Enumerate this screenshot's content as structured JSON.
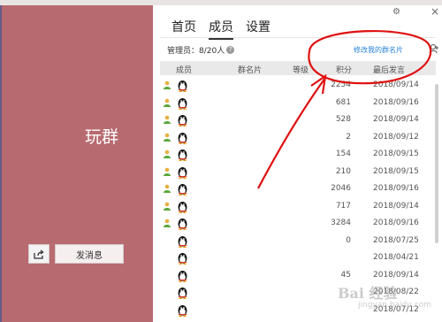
{
  "group": {
    "name": "玩群"
  },
  "left_actions": {
    "send_message_label": "发消息"
  },
  "window_controls": {
    "settings": "⚙",
    "close": "×"
  },
  "tabs": [
    {
      "label": "首页",
      "active": false
    },
    {
      "label": "成员",
      "active": true
    },
    {
      "label": "设置",
      "active": false
    }
  ],
  "members_header": {
    "admin_count": "管理员：8/20人",
    "edit_card_label": "修改我的群名片"
  },
  "table": {
    "columns": [
      "成员",
      "群名片",
      "等级",
      "积分",
      "最后发言"
    ],
    "rows": [
      {
        "admin": true,
        "points": "2254",
        "last": "2018/09/14"
      },
      {
        "admin": true,
        "points": "681",
        "last": "2018/09/16"
      },
      {
        "admin": true,
        "points": "528",
        "last": "2018/09/14"
      },
      {
        "admin": true,
        "points": "2",
        "last": "2018/09/12"
      },
      {
        "admin": true,
        "points": "154",
        "last": "2018/09/15"
      },
      {
        "admin": true,
        "points": "210",
        "last": "2018/09/15"
      },
      {
        "admin": true,
        "points": "2046",
        "last": "2018/09/16"
      },
      {
        "admin": true,
        "points": "717",
        "last": "2018/09/14"
      },
      {
        "admin": true,
        "points": "3284",
        "last": "2018/09/16"
      },
      {
        "admin": false,
        "points": "0",
        "last": "2018/07/25"
      },
      {
        "admin": false,
        "points": "",
        "last": "2018/04/21"
      },
      {
        "admin": false,
        "points": "45",
        "last": "2018/09/14"
      },
      {
        "admin": false,
        "points": "",
        "last": "2018/08/22"
      },
      {
        "admin": false,
        "points": "",
        "last": "2018/07/12"
      }
    ]
  },
  "watermark": {
    "text": "Bai 经验",
    "sub": "jingyan.baidu.com"
  },
  "colors": {
    "sidebar": "#b76b70",
    "link": "#2a84d8",
    "annotation": "#e01010"
  }
}
